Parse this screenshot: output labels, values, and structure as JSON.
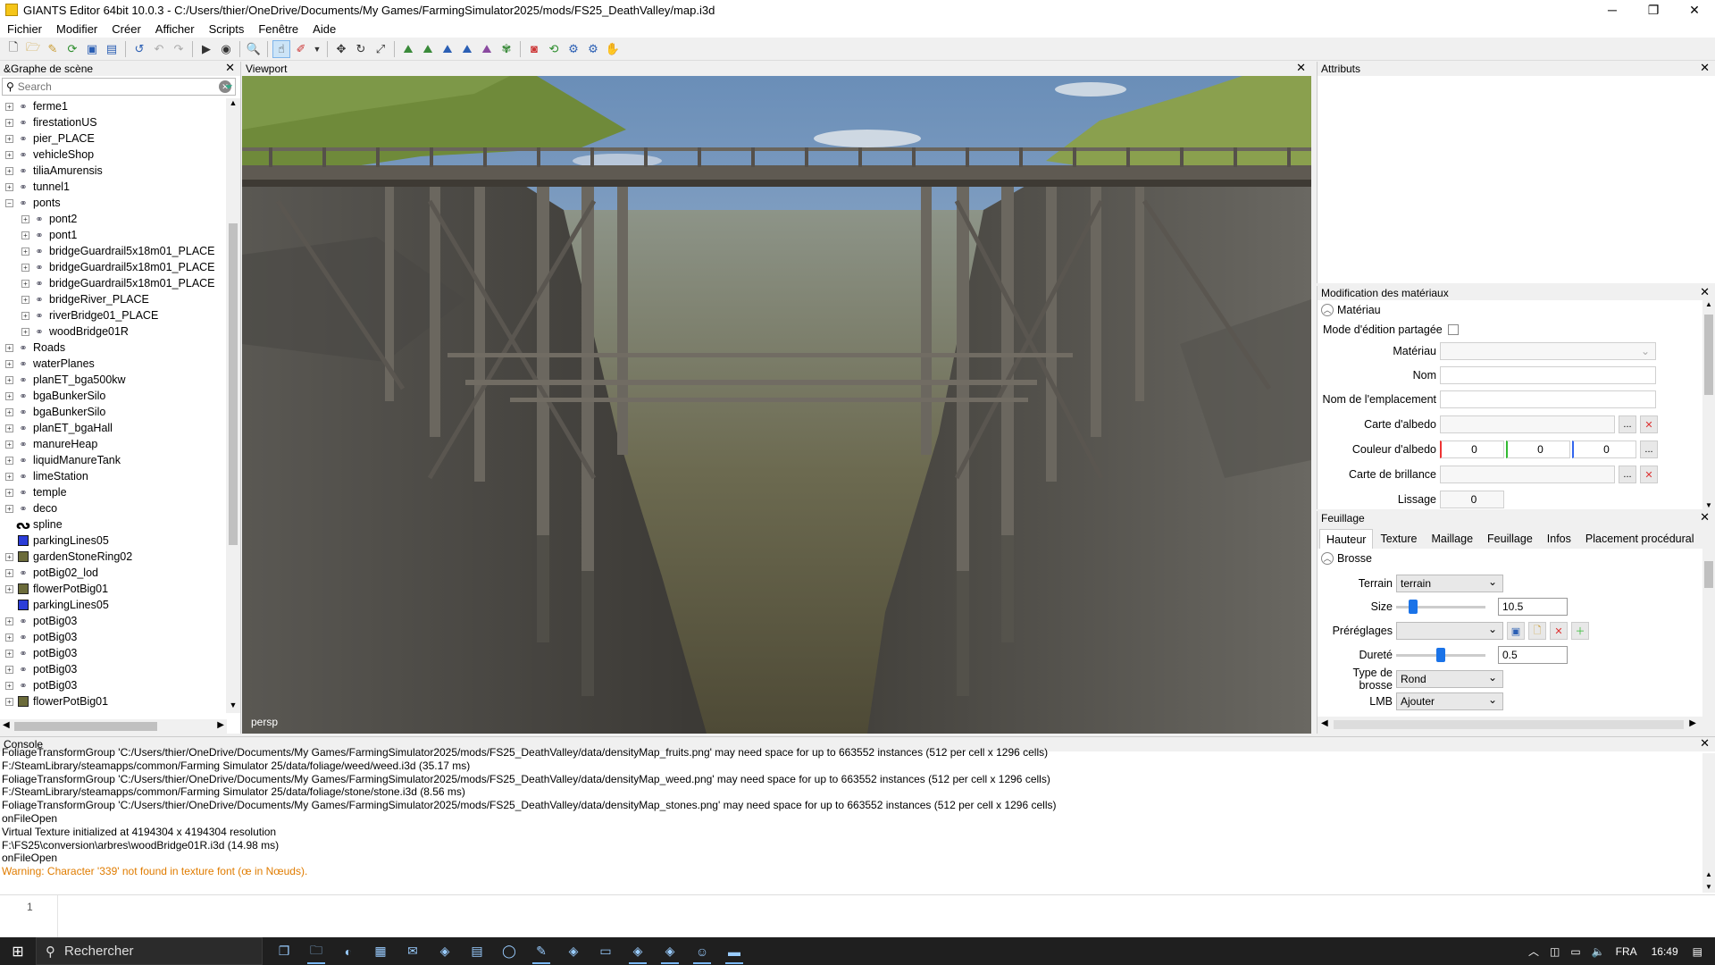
{
  "window": {
    "title": "GIANTS Editor 64bit 10.0.3 - C:/Users/thier/OneDrive/Documents/My Games/FarmingSimulator2025/mods/FS25_DeathValley/map.i3d",
    "icon": "giants-app-icon",
    "minimize": "─",
    "maximize": "❐",
    "close": "✕"
  },
  "menu": [
    "Fichier",
    "Modifier",
    "Créer",
    "Afficher",
    "Scripts",
    "Fenêtre",
    "Aide"
  ],
  "scene_graph": {
    "title": "&Graphe de scène",
    "search_placeholder": "Search",
    "items": [
      {
        "label": "ferme1",
        "depth": 0,
        "expand": "+",
        "icon": "transform-group-icon"
      },
      {
        "label": "firestationUS",
        "depth": 0,
        "expand": "+",
        "icon": "transform-group-icon"
      },
      {
        "label": "pier_PLACE",
        "depth": 0,
        "expand": "+",
        "icon": "transform-group-icon"
      },
      {
        "label": "vehicleShop",
        "depth": 0,
        "expand": "+",
        "icon": "transform-group-icon"
      },
      {
        "label": "tiliaAmurensis",
        "depth": 0,
        "expand": "+",
        "icon": "transform-group-icon"
      },
      {
        "label": "tunnel1",
        "depth": 0,
        "expand": "+",
        "icon": "transform-group-icon"
      },
      {
        "label": "ponts",
        "depth": 0,
        "expand": "−",
        "icon": "transform-group-icon"
      },
      {
        "label": "pont2",
        "depth": 1,
        "expand": "+",
        "icon": "transform-group-icon"
      },
      {
        "label": "pont1",
        "depth": 1,
        "expand": "+",
        "icon": "transform-group-icon"
      },
      {
        "label": "bridgeGuardrail5x18m01_PLACE",
        "depth": 1,
        "expand": "+",
        "icon": "transform-group-icon"
      },
      {
        "label": "bridgeGuardrail5x18m01_PLACE",
        "depth": 1,
        "expand": "+",
        "icon": "transform-group-icon"
      },
      {
        "label": "bridgeGuardrail5x18m01_PLACE",
        "depth": 1,
        "expand": "+",
        "icon": "transform-group-icon"
      },
      {
        "label": "bridgeRiver_PLACE",
        "depth": 1,
        "expand": "+",
        "icon": "transform-group-icon"
      },
      {
        "label": "riverBridge01_PLACE",
        "depth": 1,
        "expand": "+",
        "icon": "transform-group-icon"
      },
      {
        "label": "woodBridge01R",
        "depth": 1,
        "expand": "+",
        "icon": "transform-group-icon"
      },
      {
        "label": "Roads",
        "depth": 0,
        "expand": "+",
        "icon": "transform-group-icon"
      },
      {
        "label": "waterPlanes",
        "depth": 0,
        "expand": "+",
        "icon": "transform-group-icon"
      },
      {
        "label": "planET_bga500kw",
        "depth": 0,
        "expand": "+",
        "icon": "transform-group-icon"
      },
      {
        "label": "bgaBunkerSilo",
        "depth": 0,
        "expand": "+",
        "icon": "transform-group-icon"
      },
      {
        "label": "bgaBunkerSilo",
        "depth": 0,
        "expand": "+",
        "icon": "transform-group-icon"
      },
      {
        "label": "planET_bgaHall",
        "depth": 0,
        "expand": "+",
        "icon": "transform-group-icon"
      },
      {
        "label": "manureHeap",
        "depth": 0,
        "expand": "+",
        "icon": "transform-group-icon"
      },
      {
        "label": "liquidManureTank",
        "depth": 0,
        "expand": "+",
        "icon": "transform-group-icon"
      },
      {
        "label": "limeStation",
        "depth": 0,
        "expand": "+",
        "icon": "transform-group-icon"
      },
      {
        "label": "temple",
        "depth": 0,
        "expand": "+",
        "icon": "transform-group-icon"
      },
      {
        "label": "deco",
        "depth": 0,
        "expand": "+",
        "icon": "transform-group-icon"
      },
      {
        "label": "spline",
        "depth": 0,
        "expand": "",
        "icon": "spline-icon"
      },
      {
        "label": "parkingLines05",
        "depth": 0,
        "expand": "",
        "icon": "shape-icon"
      },
      {
        "label": "gardenStoneRing02",
        "depth": 0,
        "expand": "+",
        "icon": "image-node-icon"
      },
      {
        "label": "potBig02_lod",
        "depth": 0,
        "expand": "+",
        "icon": "transform-group-icon"
      },
      {
        "label": "flowerPotBig01",
        "depth": 0,
        "expand": "+",
        "icon": "image-node-icon"
      },
      {
        "label": "parkingLines05",
        "depth": 0,
        "expand": "",
        "icon": "shape-icon"
      },
      {
        "label": "potBig03",
        "depth": 0,
        "expand": "+",
        "icon": "transform-group-icon"
      },
      {
        "label": "potBig03",
        "depth": 0,
        "expand": "+",
        "icon": "transform-group-icon"
      },
      {
        "label": "potBig03",
        "depth": 0,
        "expand": "+",
        "icon": "transform-group-icon"
      },
      {
        "label": "potBig03",
        "depth": 0,
        "expand": "+",
        "icon": "transform-group-icon"
      },
      {
        "label": "potBig03",
        "depth": 0,
        "expand": "+",
        "icon": "transform-group-icon"
      },
      {
        "label": "flowerPotBig01",
        "depth": 0,
        "expand": "+",
        "icon": "image-node-icon"
      }
    ]
  },
  "viewport": {
    "title": "Viewport",
    "camera_label": "persp"
  },
  "attributes": {
    "title": "Attributs"
  },
  "materials": {
    "title": "Modification des matériaux",
    "section": "Matériau",
    "shared_edit_label": "Mode d'édition partagée",
    "material_label": "Matériau",
    "name_label": "Nom",
    "location_label": "Nom de l'emplacement",
    "albedo_map_label": "Carte d'albedo",
    "albedo_color_label": "Couleur d'albedo",
    "albedo_r": "0",
    "albedo_g": "0",
    "albedo_b": "0",
    "gloss_map_label": "Carte de brillance",
    "smoothing_label": "Lissage",
    "smoothing_value": "0",
    "browse": "...",
    "clear": "✕"
  },
  "foliage": {
    "title": "Feuillage",
    "tabs": [
      "Hauteur",
      "Texture",
      "Maillage",
      "Feuillage",
      "Infos",
      "Placement procédural"
    ],
    "section": "Brosse",
    "terrain_label": "Terrain",
    "terrain_value": "terrain",
    "size_label": "Size",
    "size_value": "10.5",
    "size_level": 0.15,
    "presets_label": "Préréglages",
    "presets_value": "",
    "hardness_label": "Dureté",
    "hardness_value": "0.5",
    "hardness_level": 0.5,
    "brush_type_label": "Type de brosse",
    "brush_type_value": "Rond",
    "lmb_label": "LMB",
    "lmb_value": "Ajouter"
  },
  "console": {
    "title": "Console",
    "lines": [
      {
        "text": "FoliageTransformGroup 'C:/Users/thier/OneDrive/Documents/My Games/FarmingSimulator2025/mods/FS25_DeathValley/data/densityMap_fruits.png' may need space for up to 663552 instances (512 per cell x 1296 cells)",
        "level": "info"
      },
      {
        "text": "F:/SteamLibrary/steamapps/common/Farming Simulator 25/data/foliage/weed/weed.i3d (35.17 ms)",
        "level": "info"
      },
      {
        "text": "FoliageTransformGroup 'C:/Users/thier/OneDrive/Documents/My Games/FarmingSimulator2025/mods/FS25_DeathValley/data/densityMap_weed.png' may need space for up to 663552 instances (512 per cell x 1296 cells)",
        "level": "info"
      },
      {
        "text": "F:/SteamLibrary/steamapps/common/Farming Simulator 25/data/foliage/stone/stone.i3d (8.56 ms)",
        "level": "info"
      },
      {
        "text": "FoliageTransformGroup 'C:/Users/thier/OneDrive/Documents/My Games/FarmingSimulator2025/mods/FS25_DeathValley/data/densityMap_stones.png' may need space for up to 663552 instances (512 per cell x 1296 cells)",
        "level": "info"
      },
      {
        "text": "onFileOpen",
        "level": "info"
      },
      {
        "text": "Virtual Texture initialized at 4194304 x 4194304 resolution",
        "level": "info"
      },
      {
        "text": "F:\\FS25\\conversion\\arbres\\woodBridge01R.i3d (14.98 ms)",
        "level": "info"
      },
      {
        "text": "onFileOpen",
        "level": "info"
      },
      {
        "text": "Warning: Character '339' not found in texture font (œ in Nœuds).",
        "level": "warn"
      }
    ],
    "input_line_number": "1"
  },
  "taskbar": {
    "search_placeholder": "Rechercher",
    "apps": [
      "task-view-icon",
      "file-explorer-icon",
      "edge-icon",
      "store-icon",
      "outlook-icon",
      "app-icon",
      "calculator-icon",
      "opera-icon",
      "giants-editor-icon",
      "app-icon",
      "terminal-icon",
      "app-icon",
      "app-icon",
      "discord-icon",
      "folder-icon"
    ],
    "language": "FRA",
    "time": "16:49"
  },
  "colors": {
    "accent": "#1a73e8",
    "warning_text": "#e07c00",
    "taskbar": "#1f1f1f"
  }
}
